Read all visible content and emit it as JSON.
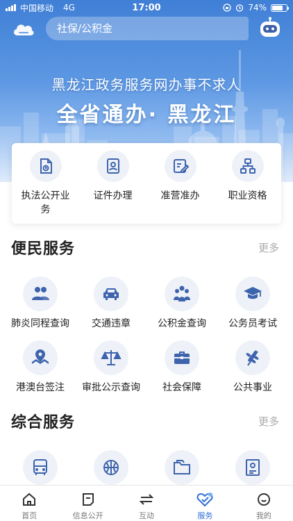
{
  "status_bar": {
    "carrier": "中国移动",
    "network": "4G",
    "time": "17:00",
    "battery_text": "74%",
    "battery_level": 0.74
  },
  "header": {
    "search_placeholder": "社保/公积金",
    "banner_subtitle": "黑龙江政务服务网办事不求人",
    "banner_title": "全省通办· 黑龙江"
  },
  "quick_access": [
    {
      "label": "执法公开业务",
      "icon": "law-document-icon"
    },
    {
      "label": "证件办理",
      "icon": "id-card-icon"
    },
    {
      "label": "准营准办",
      "icon": "edit-form-icon"
    },
    {
      "label": "职业资格",
      "icon": "org-chart-icon"
    }
  ],
  "convenience": {
    "title": "便民服务",
    "more": "更多",
    "items": [
      {
        "label": "肺炎同程查询",
        "icon": "people-icon"
      },
      {
        "label": "交通违章",
        "icon": "car-icon"
      },
      {
        "label": "公积金查询",
        "icon": "group-icon"
      },
      {
        "label": "公务员考试",
        "icon": "graduation-cap-icon"
      },
      {
        "label": "港澳台签注",
        "icon": "map-pin-icon"
      },
      {
        "label": "审批公示查询",
        "icon": "scales-icon"
      },
      {
        "label": "社会保障",
        "icon": "toolbox-icon"
      },
      {
        "label": "公共事业",
        "icon": "wheat-icon"
      }
    ]
  },
  "comprehensive": {
    "title": "综合服务",
    "more": "更多",
    "items": [
      {
        "label": "",
        "icon": "bus-icon"
      },
      {
        "label": "",
        "icon": "basketball-icon"
      },
      {
        "label": "",
        "icon": "folder-icon"
      },
      {
        "label": "",
        "icon": "certificate-icon"
      }
    ]
  },
  "tab_bar": {
    "active": "服务",
    "items": [
      {
        "label": "首页",
        "icon": "home-icon"
      },
      {
        "label": "信息公开",
        "icon": "message-icon"
      },
      {
        "label": "互动",
        "icon": "exchange-icon"
      },
      {
        "label": "服务",
        "icon": "heart-check-icon"
      },
      {
        "label": "我的",
        "icon": "user-icon"
      }
    ]
  },
  "colors": {
    "accent": "#2f6fd6",
    "icon_blue": "#3d63ad",
    "icon_bg": "#eef2f8",
    "hero_top": "#3f7fd6"
  }
}
